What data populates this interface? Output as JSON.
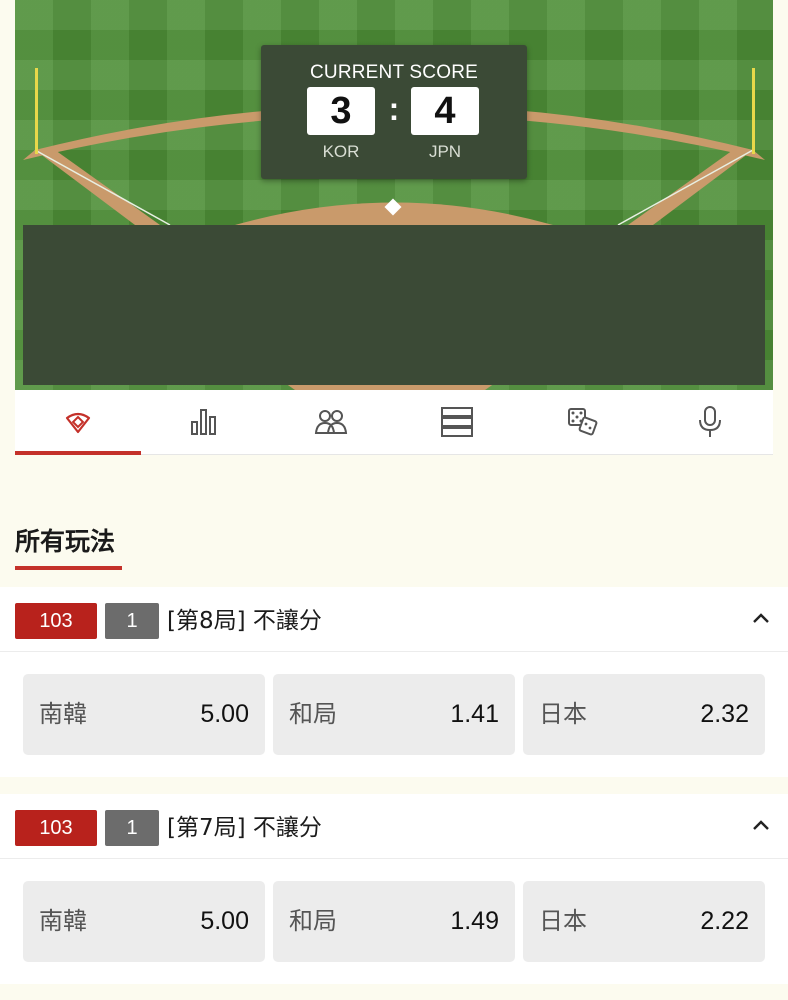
{
  "scoreboard": {
    "title": "CURRENT SCORE",
    "home": {
      "score": "3",
      "team": "KOR"
    },
    "separator": ":",
    "away": {
      "score": "4",
      "team": "JPN"
    }
  },
  "tabs": [
    {
      "icon": "field-icon",
      "active": true
    },
    {
      "icon": "stats-icon",
      "active": false
    },
    {
      "icon": "lineup-icon",
      "active": false
    },
    {
      "icon": "list-icon",
      "active": false
    },
    {
      "icon": "dice-icon",
      "active": false
    },
    {
      "icon": "microphone-icon",
      "active": false
    }
  ],
  "section": {
    "title": "所有玩法"
  },
  "markets": [
    {
      "id": "103",
      "num": "1",
      "title": "[第8局] 不讓分",
      "odds": [
        {
          "label": "南韓",
          "value": "5.00"
        },
        {
          "label": "和局",
          "value": "1.41"
        },
        {
          "label": "日本",
          "value": "2.32"
        }
      ]
    },
    {
      "id": "103",
      "num": "1",
      "title": "[第7局] 不讓分",
      "odds": [
        {
          "label": "南韓",
          "value": "5.00"
        },
        {
          "label": "和局",
          "value": "1.49"
        },
        {
          "label": "日本",
          "value": "2.22"
        }
      ]
    }
  ],
  "colors": {
    "accent": "#c4312a",
    "badge_id": "#b8221c",
    "badge_num": "#6c6c6c",
    "scoreboard_bg": "#3b4a36",
    "field": "#4e8f37",
    "page_bg": "#fcfbef"
  }
}
